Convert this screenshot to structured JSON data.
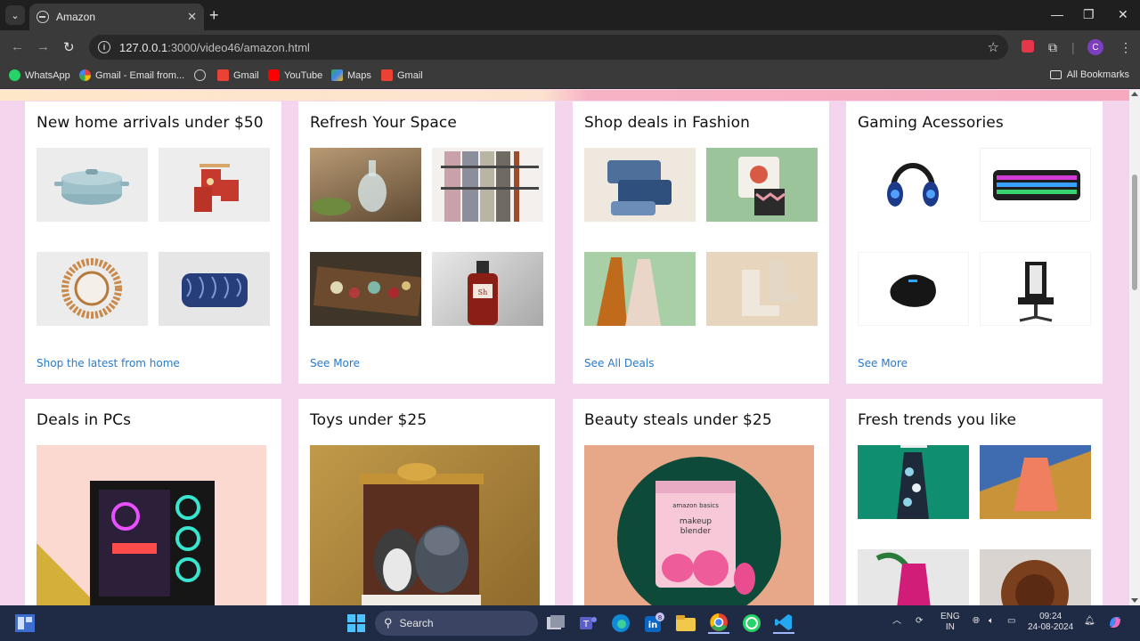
{
  "browser": {
    "tab_title": "Amazon",
    "url_host": "127.0.0.1",
    "url_rest": ":3000/video46/amazon.html",
    "avatar_letter": "C",
    "bookmarks": [
      "WhatsApp",
      "Gmail - Email from...",
      "Gmail",
      "YouTube",
      "Maps",
      "Gmail"
    ],
    "all_bookmarks": "All Bookmarks"
  },
  "cards": [
    {
      "title": "New home arrivals under $50",
      "link": "Shop the latest from home"
    },
    {
      "title": "Refresh Your Space",
      "link": "See More"
    },
    {
      "title": "Shop deals in Fashion",
      "link": "See All Deals"
    },
    {
      "title": "Gaming Acessories",
      "link": "See More"
    },
    {
      "title": "Deals in PCs"
    },
    {
      "title": "Toys under $25"
    },
    {
      "title": "Beauty steals under $25"
    },
    {
      "title": "Fresh trends you like"
    }
  ],
  "beauty_pack": {
    "brand": "amazon basics",
    "name_line1": "makeup",
    "name_line2": "blender"
  },
  "taskbar": {
    "search_placeholder": "Search",
    "lang_line1": "ENG",
    "lang_line2": "IN",
    "time": "09:24",
    "date": "24-08-2024",
    "linkedin_badge": "8"
  },
  "colors": {
    "page_bg": "#f3d6ee",
    "link": "#2a7ac9",
    "taskbar": "#1f2a44"
  }
}
